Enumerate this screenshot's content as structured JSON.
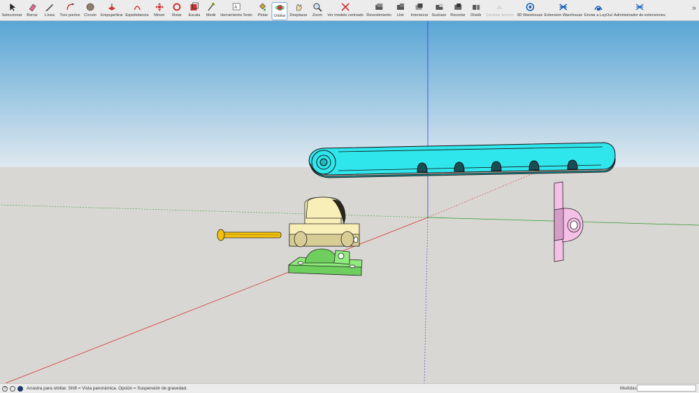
{
  "toolbar": {
    "tools": [
      {
        "label": "Seleccionar",
        "icon": "select-arrow-icon"
      },
      {
        "label": "Borrar",
        "icon": "eraser-icon"
      },
      {
        "label": "Línea",
        "icon": "pencil-line-icon"
      },
      {
        "label": "Tres puntos",
        "icon": "arc-three-points-icon"
      },
      {
        "label": "Círculo",
        "icon": "circle-icon"
      },
      {
        "label": "Empujar/tirar",
        "icon": "push-pull-icon"
      },
      {
        "label": "Equidistancia",
        "icon": "offset-icon"
      },
      {
        "label": "Mover",
        "icon": "move-icon"
      },
      {
        "label": "Rotar",
        "icon": "rotate-icon"
      },
      {
        "label": "Escala",
        "icon": "scale-icon"
      },
      {
        "label": "Medir",
        "icon": "tape-measure-icon"
      },
      {
        "label": "Herramienta Texto",
        "icon": "text-tool-icon"
      },
      {
        "label": "Pintar",
        "icon": "paint-bucket-icon"
      },
      {
        "label": "Orbitar",
        "icon": "orbit-icon"
      },
      {
        "label": "Desplazar",
        "icon": "pan-hand-icon"
      },
      {
        "label": "Zoom",
        "icon": "zoom-icon"
      },
      {
        "label": "Ver modelo centrado",
        "icon": "zoom-extents-icon"
      },
      {
        "label": "Revestimiento",
        "icon": "outer-shell-icon"
      },
      {
        "label": "Unir",
        "icon": "union-icon"
      },
      {
        "label": "Intersecar",
        "icon": "intersect-icon"
      },
      {
        "label": "Sustraer",
        "icon": "subtract-icon"
      },
      {
        "label": "Recortar",
        "icon": "trim-icon"
      },
      {
        "label": "Dividir",
        "icon": "split-icon"
      },
      {
        "label": "Cambiar terreno",
        "icon": "flip-terrain-icon"
      },
      {
        "label": "3D Warehouse",
        "icon": "warehouse-icon"
      },
      {
        "label": "Extension Warehouse",
        "icon": "extension-warehouse-icon"
      },
      {
        "label": "Enviar a LayOut",
        "icon": "layout-icon"
      },
      {
        "label": "Administrador de extensiones",
        "icon": "extension-manager-icon"
      }
    ],
    "active_tool": "Orbitar",
    "disabled_tool": "Cambiar terreno",
    "overflow_icon": "chevron-double-right-icon"
  },
  "status": {
    "message": "Arrastra para orbitar. Shift = Vista panorámica. Opción = Suspensión de gravedad.",
    "help_icon": "?",
    "measure_label": "Medidas",
    "measure_value": ""
  },
  "colors": {
    "sky_top": "#5aa6d6",
    "sky_bottom": "#dfe8ef",
    "ground": "#d9d7d3",
    "red_axis": "#d33434",
    "green_axis": "#2f9b2f",
    "blue_axis": "#3440d0",
    "cyan_part": "#2fe6ec",
    "yellow_part": "#f8efb8",
    "green_part": "#8fec7c",
    "pin": "#f4c20d",
    "pink_part": "#f5c0e6"
  }
}
